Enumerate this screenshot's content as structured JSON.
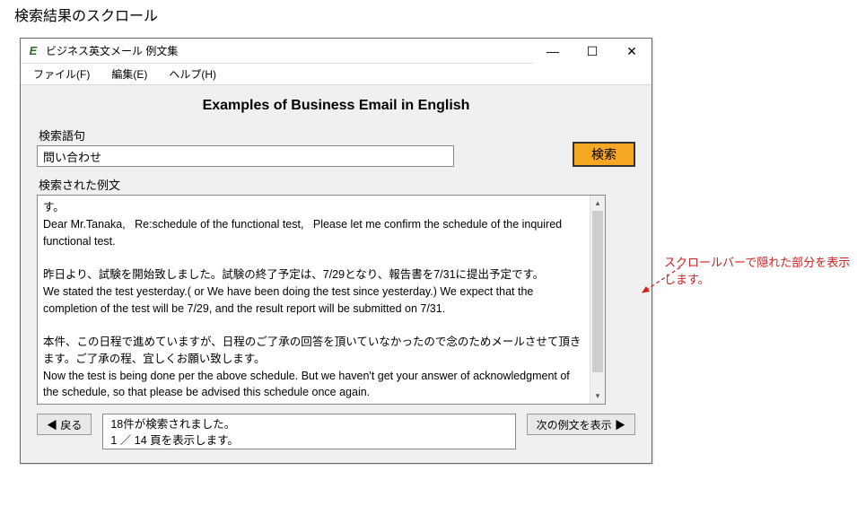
{
  "page_title": "検索結果のスクロール",
  "window": {
    "title": "ビジネス英文メール 例文集",
    "icon_glyph": "E"
  },
  "menu": {
    "file": "ファイル(F)",
    "edit": "編集(E)",
    "help": "ヘルプ(H)"
  },
  "heading": "Examples of Business Email in English",
  "search": {
    "label": "検索語句",
    "value": "問い合わせ",
    "button": "検索"
  },
  "results": {
    "label": "検索された例文",
    "text": "す。\nDear Mr.Tanaka,   Re:schedule of the functional test,   Please let me confirm the schedule of the inquired functional test.\n\n昨日より、試験を開始致しました。試験の終了予定は、7/29となり、報告書を7/31に提出予定です。\nWe stated the test yesterday.( or We have been doing the test since yesterday.) We expect that the completion of the test will be 7/29, and the result report will be submitted on 7/31.\n\n本件、この日程で進めていますが、日程のご了承の回答を頂いていなかったので念のためメールさせて頂きます。ご了承の程、宜しくお願い致します。\nNow the test is being done per the above schedule. But we haven't get your answer of acknowledgment of the schedule, so that please be advised this schedule once again.\nYou are kindly requested to accept this schedule."
  },
  "footer": {
    "back": "◀ 戻る",
    "status_line1": "18件が検索されました。",
    "status_line2": "1 ／ 14 頁を表示します。",
    "next": "次の例文を表示 ▶"
  },
  "annotation": "スクロールバーで隠れた部分を表示します。"
}
